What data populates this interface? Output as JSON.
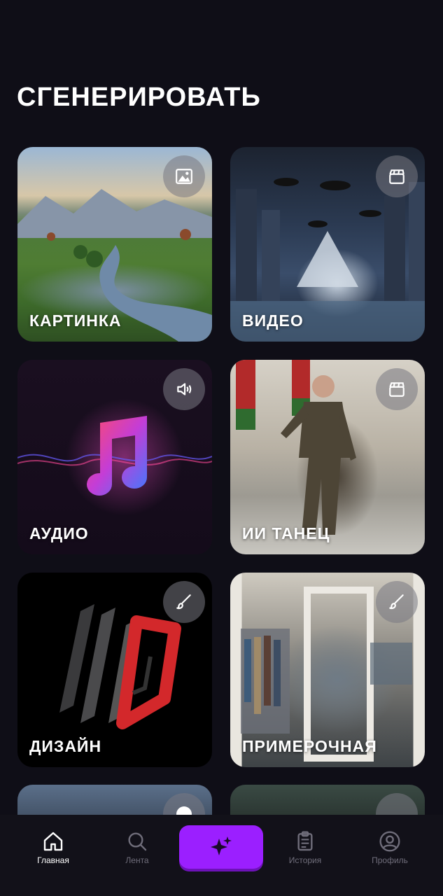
{
  "page": {
    "title": "СГЕНЕРИРОВАТЬ"
  },
  "cards": [
    {
      "label": "КАРТИНКА",
      "icon": "image-icon"
    },
    {
      "label": "ВИДЕО",
      "icon": "clapperboard-icon"
    },
    {
      "label": "АУДИО",
      "icon": "speaker-icon"
    },
    {
      "label": "ИИ ТАНЕЦ",
      "icon": "clapperboard-icon"
    },
    {
      "label": "ДИЗАЙН",
      "icon": "brush-icon"
    },
    {
      "label": "ПРИМЕРОЧНАЯ",
      "icon": "brush-icon"
    }
  ],
  "nav": {
    "items": [
      {
        "label": "Главная",
        "icon": "home-icon",
        "active": true
      },
      {
        "label": "Лента",
        "icon": "search-icon",
        "active": false
      },
      {
        "label": "История",
        "icon": "clipboard-icon",
        "active": false
      },
      {
        "label": "Профиль",
        "icon": "profile-icon",
        "active": false
      }
    ],
    "generate_icon": "sparkles-icon"
  },
  "colors": {
    "background": "#0f0e17",
    "accent": "#9b1fff"
  }
}
